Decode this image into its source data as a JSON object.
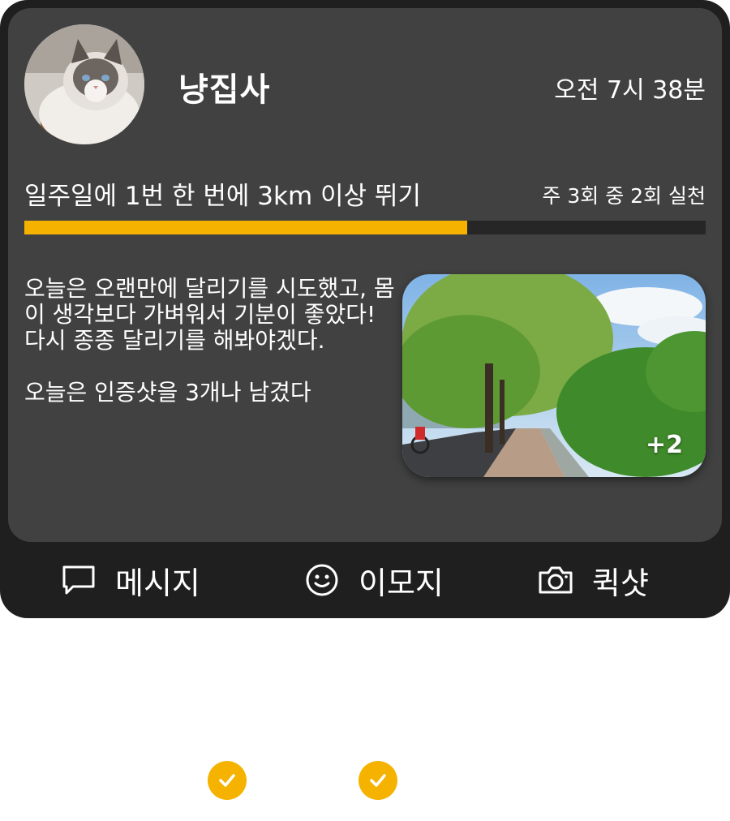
{
  "post": {
    "username": "냥집사",
    "timestamp": "오전 7시 38분",
    "avatar_icon": "cat-avatar",
    "goal": {
      "title": "일주일에 1번 한 번에 3km 이상 뛰기",
      "progress_text": "주 3회 중 2회 실천",
      "progress_fraction": 0.65
    },
    "body_text": "오늘은 오랜만에 달리기를 시도했고, 몸이 생각보다 가벼워서 기분이 좋았다! 다시 종종 달리기를 해봐야겠다.\n\n오늘은 인증샷을 3개나 남겼다",
    "photo": {
      "icon": "tree-path-photo",
      "extra_count": "+2"
    }
  },
  "actions": {
    "message": {
      "label": "메시지",
      "icon": "chat-bubble-icon"
    },
    "emoji": {
      "label": "이모지",
      "icon": "smiley-icon"
    },
    "quickshot": {
      "label": "퀵샷",
      "icon": "camera-icon"
    }
  },
  "checks": [
    {
      "icon": "checkmark-icon"
    },
    {
      "icon": "checkmark-icon"
    }
  ],
  "colors": {
    "accent": "#f5b300",
    "card_outer": "#1f1f1f",
    "card_inner": "#414141",
    "progress_track": "#262626"
  }
}
